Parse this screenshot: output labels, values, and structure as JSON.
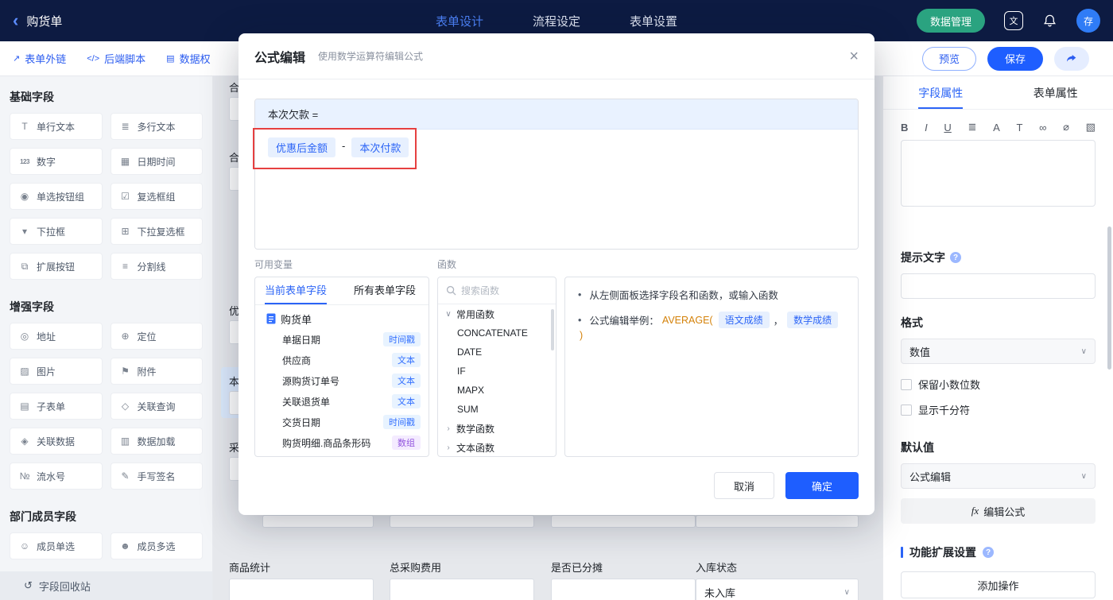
{
  "icons": {
    "back": "‹",
    "translate": "文",
    "help": "?",
    "close": "×",
    "external_link": "↗",
    "script": "</>",
    "permission": "▤",
    "single_line": "T",
    "multi_line": "≣",
    "number": "123",
    "datetime": "▦",
    "radio_group": "◉",
    "checkbox_group": "☑",
    "dropdown": "▾",
    "dropdown_multi": "⊞",
    "extend_button": "⧉",
    "divider": "≡",
    "address": "◎",
    "location": "⊕",
    "image": "▨",
    "attachment": "⚑",
    "subform": "▤",
    "linked_query": "◇",
    "linked_data": "◈",
    "data_load": "▥",
    "serial": "№",
    "signature": "✎",
    "member_single": "☺",
    "member_multi": "☻",
    "recycle": "↺",
    "bold": "B",
    "italic": "I",
    "underline": "U",
    "align": "≣",
    "font_color": "A",
    "font_size": "T",
    "link": "∞",
    "unlink": "⌀",
    "insert_image": "▧",
    "caret_down": "∨",
    "caret_right": "›",
    "select_caret": "∨",
    "bullet": "•",
    "fx": "fx"
  },
  "topbar": {
    "title": "购货单",
    "tabs": [
      "表单设计",
      "流程设定",
      "表单设置"
    ],
    "data_manage": "数据管理",
    "avatar": "存"
  },
  "toolbar": {
    "links": [
      "表单外链",
      "后端脚本",
      "数据权"
    ],
    "preview": "预览",
    "save": "保存"
  },
  "sidebar": {
    "sections": [
      {
        "title": "基础字段",
        "items": [
          "单行文本",
          "多行文本",
          "数字",
          "日期时间",
          "单选按钮组",
          "复选框组",
          "下拉框",
          "下拉复选框",
          "扩展按钮",
          "分割线"
        ]
      },
      {
        "title": "增强字段",
        "items": [
          "地址",
          "定位",
          "图片",
          "附件",
          "子表单",
          "关联查询",
          "关联数据",
          "数据加载",
          "流水号",
          "手写签名"
        ]
      },
      {
        "title": "部门成员字段",
        "items": [
          "成员单选",
          "成员多选"
        ]
      }
    ],
    "recycle": "字段回收站"
  },
  "canvas": {
    "clipped": [
      "合",
      "合",
      "优",
      "本",
      "采"
    ],
    "fields": [
      {
        "label": "商品统计",
        "value": ""
      },
      {
        "label": "总采购费用",
        "value": ""
      },
      {
        "label": "是否已分摊",
        "value": ""
      },
      {
        "label": "入库状态",
        "value": "未入库"
      }
    ]
  },
  "modal": {
    "title": "公式编辑",
    "subtitle": "使用数学运算符编辑公式",
    "target": "本次欠款 =",
    "chip_left": "优惠后金额",
    "operator": "-",
    "chip_right": "本次付款",
    "vars_label": "可用变量",
    "vars_tabs": [
      "当前表单字段",
      "所有表单字段"
    ],
    "tree_root": "购货单",
    "tree": [
      {
        "name": "单据日期",
        "type": "时间戳"
      },
      {
        "name": "供应商",
        "type": "文本"
      },
      {
        "name": "源购货订单号",
        "type": "文本"
      },
      {
        "name": "关联退货单",
        "type": "文本"
      },
      {
        "name": "交货日期",
        "type": "时间戳"
      },
      {
        "name": "购货明细.商品条形码",
        "type": "数组"
      }
    ],
    "fn_label": "函数",
    "fn_search_placeholder": "搜索函数",
    "fn_groups": [
      "常用函数",
      "数学函数",
      "文本函数"
    ],
    "fn_items": [
      "CONCATENATE",
      "DATE",
      "IF",
      "MAPX",
      "SUM"
    ],
    "tip1": "从左侧面板选择字段名和函数，或输入函数",
    "tip2_prefix": "公式编辑举例：",
    "tip2_fn": "AVERAGE(",
    "tip2_chip1": "语文成绩",
    "tip2_comma": "，",
    "tip2_chip2": "数学成绩",
    "tip2_close": ")",
    "cancel": "取消",
    "ok": "确定"
  },
  "inspector": {
    "tabs": [
      "字段属性",
      "表单属性"
    ],
    "hint_label": "提示文字",
    "format_label": "格式",
    "format_value": "数值",
    "opt1": "保留小数位数",
    "opt2": "显示千分符",
    "default_label": "默认值",
    "default_value": "公式编辑",
    "edit_formula": "编辑公式",
    "extension_title": "功能扩展设置",
    "add_action": "添加操作"
  }
}
